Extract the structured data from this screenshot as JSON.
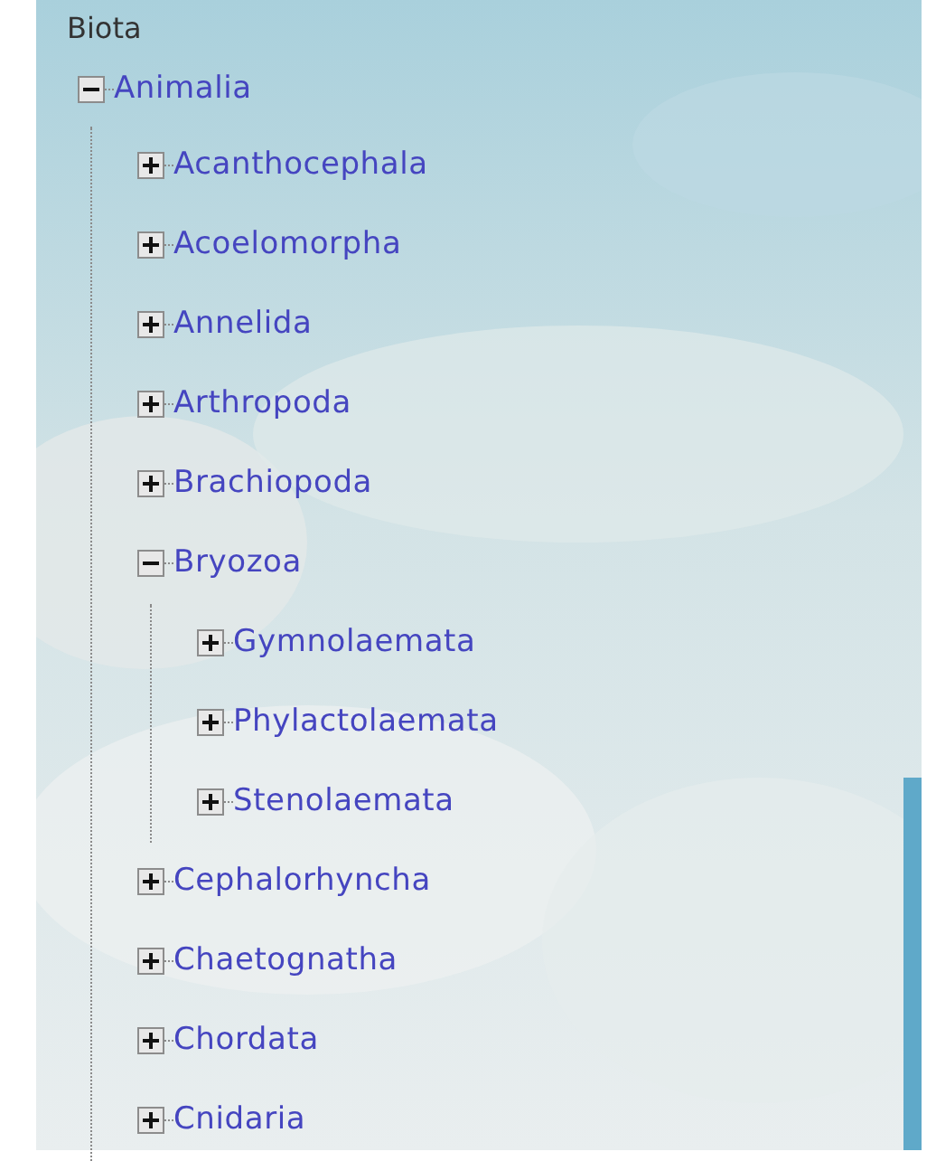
{
  "tree": {
    "label": "Biota",
    "children": [
      {
        "label": "Animalia",
        "expanded": true,
        "children": [
          {
            "label": "Acanthocephala",
            "expanded": false
          },
          {
            "label": "Acoelomorpha",
            "expanded": false
          },
          {
            "label": "Annelida",
            "expanded": false
          },
          {
            "label": "Arthropoda",
            "expanded": false
          },
          {
            "label": "Brachiopoda",
            "expanded": false
          },
          {
            "label": "Bryozoa",
            "expanded": true,
            "children": [
              {
                "label": "Gymnolaemata",
                "expanded": false
              },
              {
                "label": "Phylactolaemata",
                "expanded": false
              },
              {
                "label": "Stenolaemata",
                "expanded": false
              }
            ]
          },
          {
            "label": "Cephalorhyncha",
            "expanded": false
          },
          {
            "label": "Chaetognatha",
            "expanded": false
          },
          {
            "label": "Chordata",
            "expanded": false
          },
          {
            "label": "Cnidaria",
            "expanded": false
          }
        ]
      }
    ]
  }
}
